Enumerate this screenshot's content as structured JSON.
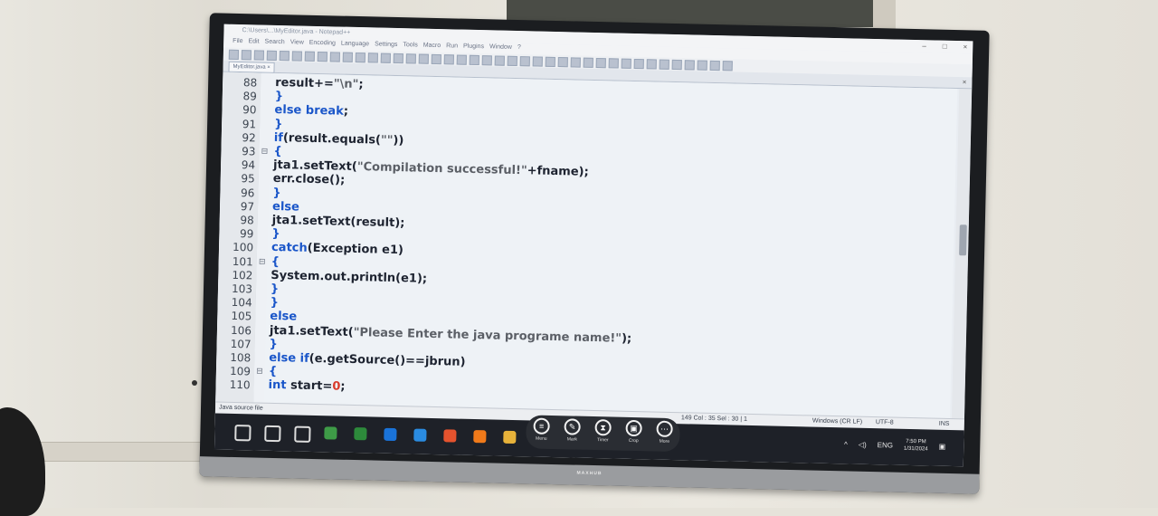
{
  "window": {
    "title": "C:\\Users\\...\\MyEditor.java - Notepad++",
    "controls": [
      "–",
      "□",
      "×"
    ]
  },
  "menu": [
    "File",
    "Edit",
    "Search",
    "View",
    "Encoding",
    "Language",
    "Settings",
    "Tools",
    "Macro",
    "Run",
    "Plugins",
    "Window",
    "?"
  ],
  "tab": {
    "label": "MyEditor.java",
    "close": "×"
  },
  "editor": {
    "lines": [
      {
        "n": "88",
        "fold": "",
        "segs": [
          [
            "result+=",
            ""
          ],
          [
            "\"\\n\"",
            "str"
          ],
          [
            ";",
            ""
          ]
        ]
      },
      {
        "n": "89",
        "fold": "",
        "segs": [
          [
            "}",
            "kw"
          ]
        ]
      },
      {
        "n": "90",
        "fold": "",
        "segs": [
          [
            "else break",
            "kw"
          ],
          [
            ";",
            ""
          ]
        ]
      },
      {
        "n": "91",
        "fold": "",
        "segs": [
          [
            "}",
            "kw"
          ]
        ]
      },
      {
        "n": "92",
        "fold": "",
        "segs": [
          [
            "if",
            "kw"
          ],
          [
            "(result.equals(",
            ""
          ],
          [
            "\"\"",
            "str"
          ],
          [
            "))",
            ""
          ]
        ]
      },
      {
        "n": "93",
        "fold": "⊟",
        "segs": [
          [
            "{",
            "kw"
          ]
        ]
      },
      {
        "n": "94",
        "fold": "",
        "segs": [
          [
            "jta1.setText(",
            ""
          ],
          [
            "\"Compilation successful!\"",
            "str"
          ],
          [
            "+fname);",
            ""
          ]
        ]
      },
      {
        "n": "95",
        "fold": "",
        "segs": [
          [
            "err.close();",
            ""
          ]
        ]
      },
      {
        "n": "96",
        "fold": "",
        "segs": [
          [
            "}",
            "kw"
          ]
        ]
      },
      {
        "n": "97",
        "fold": "",
        "segs": [
          [
            "else",
            "kw"
          ]
        ]
      },
      {
        "n": "98",
        "fold": "",
        "segs": [
          [
            "jta1.setText(result);",
            ""
          ]
        ]
      },
      {
        "n": "99",
        "fold": "",
        "segs": [
          [
            "}",
            "kw"
          ]
        ]
      },
      {
        "n": "100",
        "fold": "",
        "segs": [
          [
            "catch",
            "kw"
          ],
          [
            "(Exception e1)",
            ""
          ]
        ]
      },
      {
        "n": "101",
        "fold": "⊟",
        "segs": [
          [
            "{",
            "kw"
          ]
        ]
      },
      {
        "n": "102",
        "fold": "",
        "segs": [
          [
            "System.out.println(e1);",
            ""
          ]
        ]
      },
      {
        "n": "103",
        "fold": "",
        "segs": [
          [
            "}",
            "kw"
          ]
        ]
      },
      {
        "n": "104",
        "fold": "",
        "segs": [
          [
            "}",
            "kw"
          ]
        ]
      },
      {
        "n": "105",
        "fold": "",
        "segs": [
          [
            "else",
            "kw"
          ]
        ]
      },
      {
        "n": "106",
        "fold": "",
        "segs": [
          [
            "jta1.setText(",
            ""
          ],
          [
            "\"Please Enter the java programe name!\"",
            "str"
          ],
          [
            ");",
            ""
          ]
        ]
      },
      {
        "n": "107",
        "fold": "",
        "segs": [
          [
            "}",
            "kw"
          ]
        ]
      },
      {
        "n": "108",
        "fold": "",
        "segs": [
          [
            "else if",
            "kw"
          ],
          [
            "(e.getSource()==jbrun)",
            ""
          ]
        ]
      },
      {
        "n": "109",
        "fold": "⊟",
        "segs": [
          [
            "{",
            "kw"
          ]
        ]
      },
      {
        "n": "110",
        "fold": "",
        "segs": [
          [
            "int",
            "kw"
          ],
          [
            " start=",
            ""
          ],
          [
            "0",
            "num"
          ],
          [
            ";",
            ""
          ]
        ]
      }
    ]
  },
  "status": {
    "file_type": "Java source file",
    "position": "149   Col : 35   Sel : 30 | 1",
    "eol": "Windows (CR LF)",
    "encoding": "UTF-8",
    "mode": "INS"
  },
  "pen_toolbar": [
    {
      "label": "Menu",
      "icon": "menu-icon"
    },
    {
      "label": "Mark",
      "icon": "pen-icon"
    },
    {
      "label": "Timer",
      "icon": "hourglass-icon"
    },
    {
      "label": "Crop",
      "icon": "crop-icon"
    },
    {
      "label": "More",
      "icon": "more-icon"
    }
  ],
  "taskbar": {
    "apps": [
      "start-icon",
      "search-icon",
      "task-view-icon",
      "app-icon",
      "app-icon",
      "edge-legacy-icon",
      "edge-icon",
      "brave-icon",
      "firefox-icon",
      "file-explorer-icon"
    ],
    "language": "ENG",
    "time": "7:50 PM",
    "date": "1/31/2024"
  },
  "tv_brand": "MAXHUB"
}
